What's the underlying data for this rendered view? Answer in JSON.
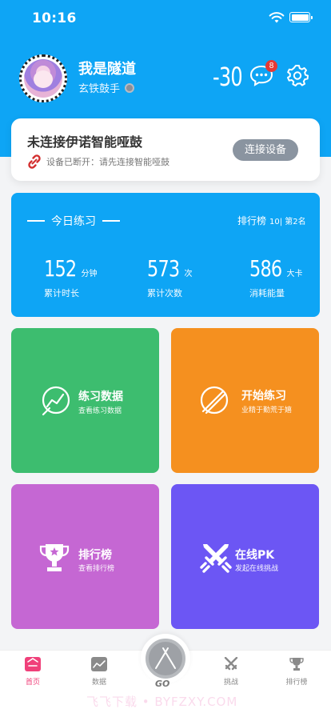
{
  "status_bar": {
    "time": "10:16"
  },
  "profile": {
    "name": "我是隧道",
    "title": "玄铁鼓手",
    "score": "-30",
    "message_count": "8"
  },
  "connect": {
    "title": "未连接伊诺智能哑鼓",
    "status": "设备已断开：请先连接智能哑鼓",
    "button": "连接设备"
  },
  "today": {
    "heading": "今日练习",
    "rank_label": "排行榜",
    "rank_value": "10| 第2名",
    "stats": [
      {
        "value": "152",
        "unit": "分钟",
        "label": "累计时长"
      },
      {
        "value": "573",
        "unit": "次",
        "label": "累计次数"
      },
      {
        "value": "586",
        "unit": "大卡",
        "label": "消耗能量"
      }
    ]
  },
  "tiles": [
    {
      "title": "练习数据",
      "subtitle": "查看练习数据",
      "color": "#3dbd6f"
    },
    {
      "title": "开始练习",
      "subtitle": "业精于勤荒于嬉",
      "color": "#f5901f"
    },
    {
      "title": "排行榜",
      "subtitle": "查看排行榜",
      "color": "#c567d3"
    },
    {
      "title": "在线PK",
      "subtitle": "发起在线挑战",
      "color": "#6c56f4"
    }
  ],
  "tabbar": {
    "items": [
      "首页",
      "数据",
      "挑战",
      "排行榜"
    ],
    "center_label": "GO",
    "active_color": "#f0407a"
  },
  "watermark": "飞飞下载 • BYFZXY.COM",
  "colors": {
    "brand": "#0ea5f5",
    "badge": "#e53935"
  }
}
